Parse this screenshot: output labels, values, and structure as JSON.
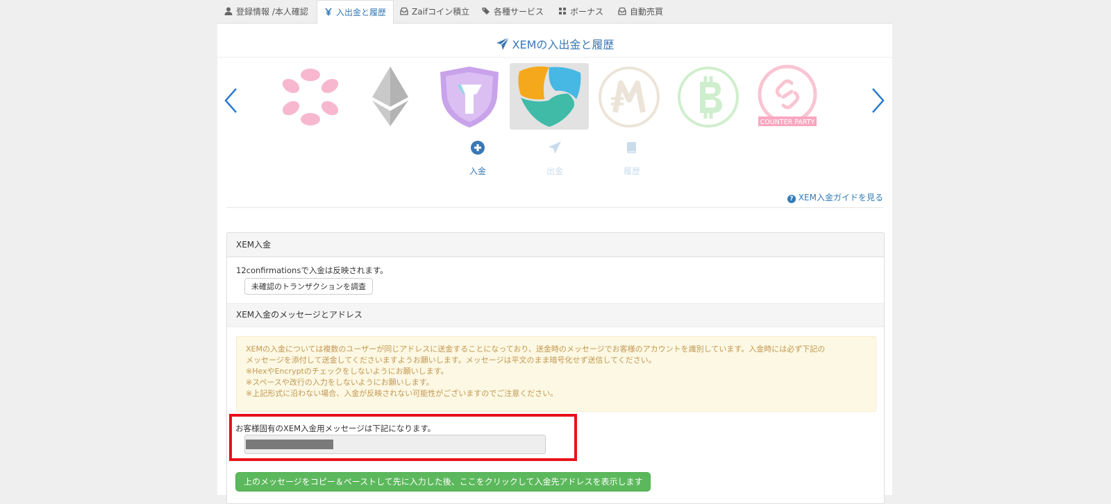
{
  "tabs": [
    {
      "label": "登録情報 /本人確認",
      "icon": "user-icon"
    },
    {
      "label": "入出金と履歴",
      "icon": "yen-icon",
      "active": true
    },
    {
      "label": "Zaifコイン積立",
      "icon": "inbox-icon"
    },
    {
      "label": "各種サービス",
      "icon": "tags-icon"
    },
    {
      "label": "ボーナス",
      "icon": "grid-icon"
    },
    {
      "label": "自動売買",
      "icon": "inbox-icon"
    }
  ],
  "page_title": "XEMの入出金と履歴",
  "coins": [
    {
      "name": "polkadot-coin-icon"
    },
    {
      "name": "ethereum-coin-icon"
    },
    {
      "name": "zaif-token-coin-icon"
    },
    {
      "name": "xem-coin-icon",
      "selected": true
    },
    {
      "name": "monacoin-coin-icon"
    },
    {
      "name": "bitcoin-cash-coin-icon"
    },
    {
      "name": "counterparty-coin-icon",
      "caption": "COUNTER PARTY"
    }
  ],
  "actions": {
    "deposit": "入金",
    "withdraw": "出金",
    "history": "履歴"
  },
  "guide_link": "XEM入金ガイドを見る",
  "deposit_panel": {
    "heading": "XEM入金",
    "confirm_text": "12confirmationsで入金は反映されます。",
    "check_button": "未確認のトランザクションを調査",
    "section_heading": "XEM入金のメッセージとアドレス",
    "warning_lines": [
      "XEMの入金については複数のユーザーが同じアドレスに送金することになっており、送金時のメッセージでお客様のアカウントを識別しています。入金時には必ず下記の",
      "メッセージを添付して送金してくださいますようお願いします。メッセージは平文のまま暗号化せず送信してください。",
      "※HexやEncryptのチェックをしないようにお願いします。",
      "※スペースや改行の入力をしないようにお願いします。",
      "※上記形式に沿わない場合、入金が反映されない可能性がございますのでご注意ください。"
    ],
    "message_label": "お客様固有のXEM入金用メッセージは下記になります。",
    "show_address_button": "上のメッセージをコピー＆ペーストして先に入力した後、ここをクリックして入金先アドレスを表示します"
  },
  "colors": {
    "link": "#337ab7",
    "highlight_border": "#e8101a",
    "success": "#5cb85c",
    "warning_bg": "#fcf8e3"
  }
}
